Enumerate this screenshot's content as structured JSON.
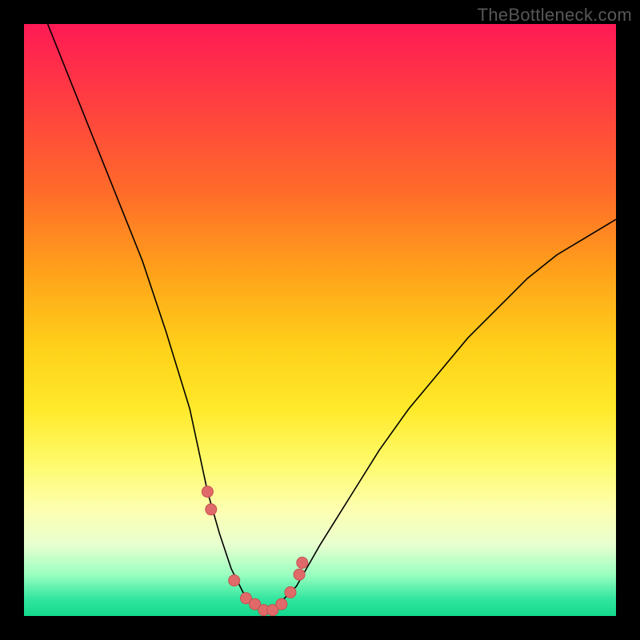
{
  "watermark": "TheBottleneck.com",
  "colors": {
    "frame_bg": "#000000",
    "gradient_top": "#ff1a55",
    "gradient_mid": "#ffe92a",
    "gradient_bottom": "#13d98d",
    "curve_stroke": "#000000",
    "marker_fill": "#e06a6a",
    "marker_stroke": "#c74f4f"
  },
  "chart_data": {
    "type": "line",
    "title": "",
    "xlabel": "",
    "ylabel": "",
    "xlim": [
      0,
      100
    ],
    "ylim": [
      0,
      100
    ],
    "x": [
      4,
      8,
      12,
      16,
      20,
      24,
      28,
      31,
      33,
      35,
      37,
      39,
      41,
      43,
      46,
      50,
      55,
      60,
      65,
      70,
      75,
      80,
      85,
      90,
      95,
      100
    ],
    "values": [
      100,
      90,
      80,
      70,
      60,
      48,
      35,
      21,
      14,
      8,
      4,
      2,
      1,
      2,
      5,
      12,
      20,
      28,
      35,
      41,
      47,
      52,
      57,
      61,
      64,
      67
    ],
    "series": [
      {
        "name": "markers",
        "x": [
          31.0,
          31.6,
          35.5,
          37.5,
          39.0,
          40.5,
          42.0,
          43.5,
          45.0,
          46.5,
          47.0
        ],
        "values": [
          21,
          18,
          6,
          3,
          2,
          1,
          1,
          2,
          4,
          7,
          9
        ]
      }
    ]
  }
}
